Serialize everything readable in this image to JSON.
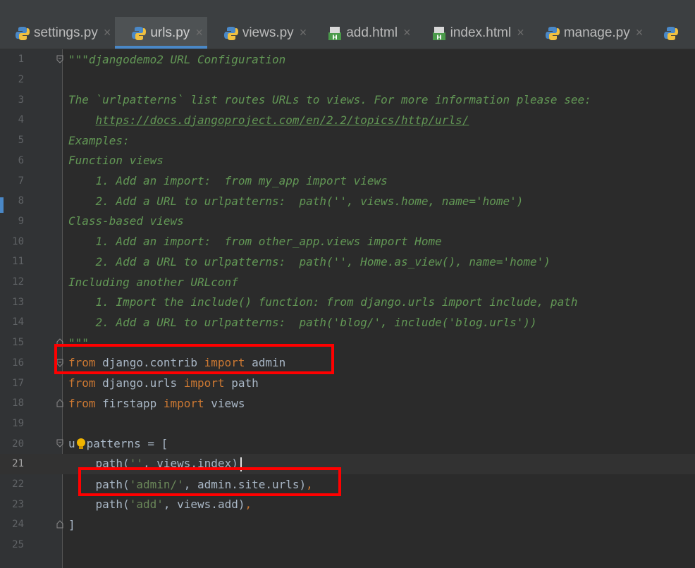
{
  "tabs": [
    {
      "label": "settings.py",
      "icon": "python-file-icon",
      "active": false
    },
    {
      "label": "urls.py",
      "icon": "python-file-icon",
      "active": true
    },
    {
      "label": "views.py",
      "icon": "python-file-icon",
      "active": false
    },
    {
      "label": "add.html",
      "icon": "html-file-icon",
      "active": false
    },
    {
      "label": "index.html",
      "icon": "html-file-icon",
      "active": false
    },
    {
      "label": "manage.py",
      "icon": "python-file-icon",
      "active": false
    }
  ],
  "tab_close_glyph": "×",
  "line_numbers": [
    "1",
    "2",
    "3",
    "4",
    "5",
    "6",
    "7",
    "8",
    "9",
    "10",
    "11",
    "12",
    "13",
    "14",
    "15",
    "16",
    "17",
    "18",
    "19",
    "20",
    "21",
    "22",
    "23",
    "24",
    "25"
  ],
  "code": {
    "l1": "\"\"\"djangodemo2 URL Configuration",
    "l3": "The `urlpatterns` list routes URLs to views. For more information please see:",
    "l4_indent": "    ",
    "l4": "https://docs.djangoproject.com/en/2.2/topics/http/urls/",
    "l5": "Examples:",
    "l6": "Function views",
    "l7": "    1. Add an import:  from my_app import views",
    "l8": "    2. Add a URL to urlpatterns:  path('', views.home, name='home')",
    "l9": "Class-based views",
    "l10": "    1. Add an import:  from other_app.views import Home",
    "l11": "    2. Add a URL to urlpatterns:  path('', Home.as_view(), name='home')",
    "l12": "Including another URLconf",
    "l13": "    1. Import the include() function: from django.urls import include, path",
    "l14": "    2. Add a URL to urlpatterns:  path('blog/', include('blog.urls'))",
    "l15": "\"\"\"",
    "l16": {
      "kw1": "from",
      "mod": " django.contrib ",
      "kw2": "import",
      "name": " admin"
    },
    "l17": {
      "kw1": "from",
      "mod": " django.urls ",
      "kw2": "import",
      "name": " path"
    },
    "l18": {
      "kw1": "from",
      "mod": " firstapp ",
      "kw2": "import",
      "name": " views"
    },
    "l20": {
      "a": "u",
      "b": "patterns = ["
    },
    "l21": {
      "a": "    path(",
      "s": "''",
      "b": ", views.index)"
    },
    "l22": {
      "a": "    path(",
      "s": "'admin/'",
      "b": ", admin.site.urls)",
      "c": ","
    },
    "l23": {
      "a": "    path(",
      "s": "'add'",
      "b": ", views.add)",
      "c": ","
    },
    "l24": "]"
  },
  "colors": {
    "background": "#2b2b2b",
    "gutter": "#313335",
    "keyword": "#cc7832",
    "string": "#6a8759",
    "docstring": "#629755",
    "highlight_box": "#ff0000"
  }
}
